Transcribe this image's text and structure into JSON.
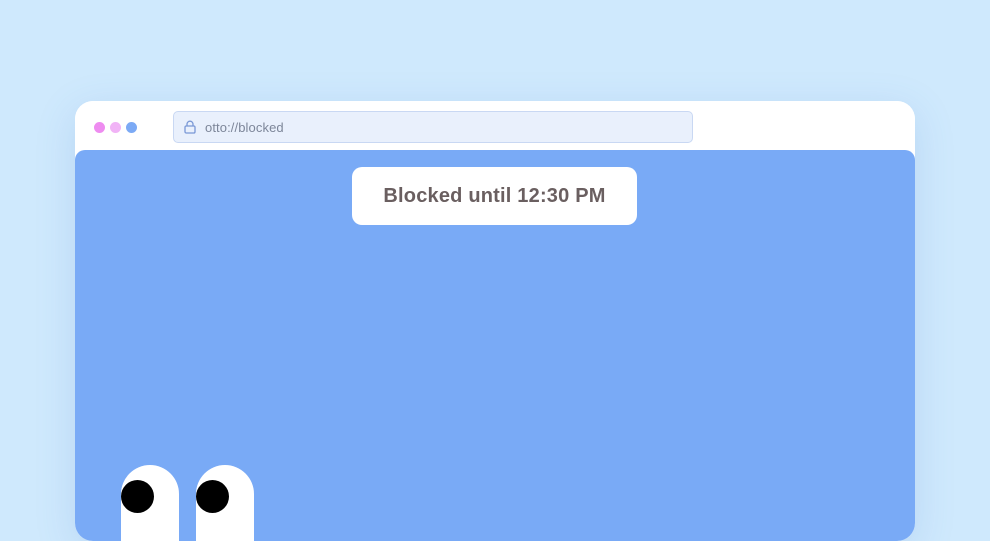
{
  "window": {
    "controls": [
      {
        "name": "close",
        "color": "#ee8cf0"
      },
      {
        "name": "minimize",
        "color": "#f1b3f6"
      },
      {
        "name": "maximize",
        "color": "#7caaf5"
      }
    ]
  },
  "address_bar": {
    "icon": "lock-icon",
    "url": "otto://blocked"
  },
  "page": {
    "background_color": "#79aaf6",
    "blocked_message": "Blocked until 12:30 PM"
  },
  "mascot": {
    "icon": "googly-eyes"
  }
}
